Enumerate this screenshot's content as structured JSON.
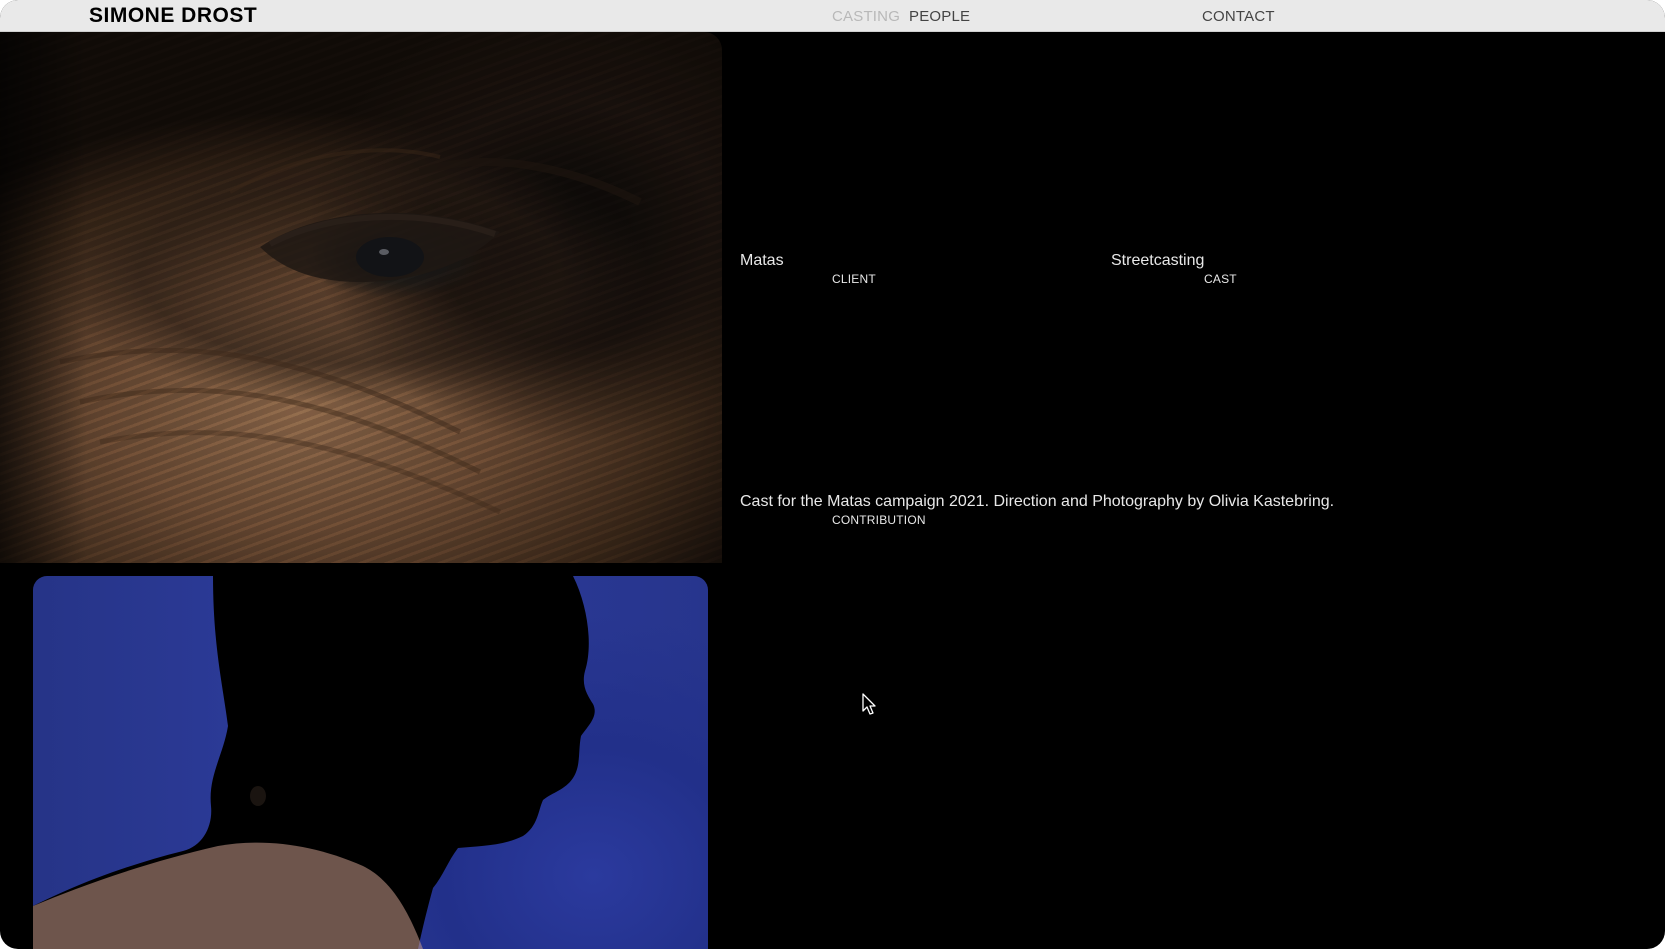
{
  "header": {
    "brand": "SIMONE DROST",
    "nav": {
      "casting": "CASTING",
      "people": "PEOPLE",
      "contact": "CONTACT"
    }
  },
  "project": {
    "client_value": "Matas",
    "client_label": "CLIENT",
    "cast_value": "Streetcasting",
    "cast_label": "CAST",
    "contribution_value": "Cast for the Matas campaign 2021. Direction and Photography by Olivia Kastebring.",
    "contribution_label": "CONTRIBUTION"
  },
  "images": {
    "first": "eye-closeup-photo",
    "second": "profile-silhouette-photo"
  },
  "colors": {
    "background": "#000000",
    "topbar": "#e9e9e9",
    "nav_inactive": "#b8b8b8",
    "nav_active": "#444444",
    "text": "#e8e8e8",
    "profile_backdrop": "#2b3a9e"
  }
}
